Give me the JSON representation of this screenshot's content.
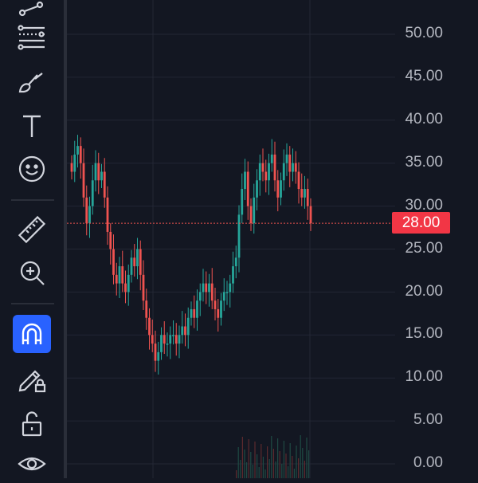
{
  "toolbar": {
    "tools": [
      {
        "name": "trend-line-tool-icon"
      },
      {
        "name": "fib-retracement-tool-icon"
      },
      {
        "name": "brush-tool-icon"
      },
      {
        "name": "text-tool-icon"
      },
      {
        "name": "emoji-tool-icon"
      },
      {
        "name": "measure-ruler-icon"
      },
      {
        "name": "zoom-in-icon"
      },
      {
        "name": "magnet-icon",
        "active": true
      },
      {
        "name": "lock-drawings-icon"
      },
      {
        "name": "unlock-icon"
      },
      {
        "name": "eye-visibility-icon"
      }
    ],
    "accent_color": "#2962ff"
  },
  "price_axis": {
    "labels": [
      "50.00",
      "45.00",
      "40.00",
      "35.00",
      "30.00",
      "25.00",
      "20.00",
      "15.00",
      "10.00",
      "5.00",
      "0.00"
    ],
    "current_price": "28.00",
    "current_price_color": "#f23645"
  },
  "chart_data": {
    "type": "candlestick",
    "ylim": [
      0,
      52
    ],
    "up_color": "#26a69a",
    "down_color": "#ef5350",
    "current_price": 28.0,
    "closes": [
      34,
      36,
      37,
      35,
      31,
      28,
      30,
      33,
      35,
      33,
      34,
      31,
      27,
      25,
      22,
      21,
      23,
      21,
      20,
      22,
      24,
      23,
      25,
      22,
      19,
      17,
      15,
      14,
      12,
      13,
      15,
      14,
      14,
      15,
      15,
      14,
      15,
      16,
      15,
      17,
      18,
      17,
      19,
      20,
      21,
      20,
      21,
      19,
      18,
      17,
      19,
      20,
      20,
      21,
      23,
      24,
      29,
      32,
      34,
      30,
      28,
      31,
      33,
      35,
      34,
      33,
      35,
      36,
      33,
      31,
      33,
      35,
      36,
      34,
      35,
      34,
      32,
      31,
      32,
      30,
      28
    ]
  }
}
